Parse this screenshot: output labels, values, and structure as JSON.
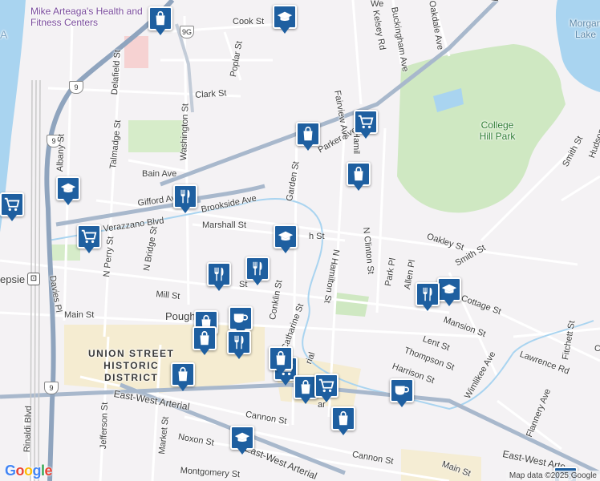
{
  "map": {
    "attribution": "Map data ©2025 Google",
    "logo": "Google",
    "colors": {
      "background": "#f4f2f4",
      "park": "#cfe8c2",
      "water": "#a9d4f0",
      "arterial": "#8fa4be",
      "road": "#ffffff",
      "marker": "#1e5fa0",
      "district_tint": "#f6e7b4"
    },
    "places": {
      "health_center": "Mike Arteaga's Health and Fitness Centers",
      "college_hill_park": "College Hill Park",
      "morgan_lake": "Morgan Lake",
      "union_street_district": "UNION STREET\nHISTORIC\nDISTRICT",
      "poughkeepsie_short": "Pough",
      "epsie_short": "epsie"
    },
    "route_shields": [
      "9G",
      "9",
      "9",
      "9"
    ],
    "streets": {
      "cook": "Cook St",
      "poplar": "Poplar St",
      "clark": "Clark St",
      "delafield": "Delafield St",
      "washington": "Washington St",
      "talmadge": "Talmadge St",
      "albany": "Albany St",
      "bain": "Bain Ave",
      "gifford": "Gifford Ave",
      "brookside": "Brookside Ave",
      "verazzano": "Verazzano Blvd",
      "marshall": "Marshall St",
      "garden": "Garden St",
      "parker": "Parker Ave",
      "fairview": "Fairview Ave",
      "kelsey": "Kelsey Rd",
      "buckingham": "Buckingham Ave",
      "oakdale": "Oakdale Ave",
      "hamilton_fragment": "Hamil",
      "smith": "Smith St",
      "hudson": "Hudson",
      "oakley": "Oakley St",
      "n_clinton": "N Clinton St",
      "n_hamilton": "N Hamilton St",
      "smith_sw": "Smith St",
      "high_fragment": "h St",
      "mill": "Mill St",
      "n_perry": "N Perry St",
      "n_bridge": "N Bridge St",
      "davies": "Davies Pl",
      "main": "Main St",
      "conklin": "Conklin St",
      "catharine": "Catharine St",
      "park_pl": "Park Pl",
      "allen_pl": "Allen Pl",
      "cottage": "Cottage St",
      "mansion": "Mansion St",
      "lent": "Lent St",
      "thompson": "Thompson St",
      "lawrence": "Lawrence Rd",
      "fitchett": "Fitchett St",
      "harrison": "Harrison St",
      "wimlikee": "Wimlikee Ave",
      "east_west_arterial": "East-West Arterial",
      "east_west_arterial_lower": "East-West Arterial",
      "east_west_arterial_right": "East-West Arte",
      "cannon": "Cannon St",
      "cannon_right": "Cannon St",
      "noxon": "Noxon St",
      "market": "Market St",
      "jefferson": "Jefferson St",
      "rinaldi": "Rinaldi Blvd",
      "montgomery": "Montgomery St",
      "flannery": "Flannery Ave",
      "main_right": "Main St",
      "fragment_st": "St",
      "fragment_sm": "Sm",
      "fragment_ve": "Ve",
      "fragment_a": "A",
      "fragment_ar": "ar",
      "fragment_co": "Co",
      "fragment_we": "We",
      "fragment_rial": "rial"
    },
    "markers": [
      {
        "name": "shopping-bag-marker-1",
        "icon": "shopping-bag-icon"
      },
      {
        "name": "school-marker-1",
        "icon": "school-icon"
      },
      {
        "name": "shopping-cart-marker-1",
        "icon": "shopping-cart-icon"
      },
      {
        "name": "shopping-bag-marker-2",
        "icon": "shopping-bag-icon"
      },
      {
        "name": "shopping-bag-marker-3",
        "icon": "shopping-bag-icon"
      },
      {
        "name": "school-marker-2",
        "icon": "school-icon"
      },
      {
        "name": "restaurant-marker-1",
        "icon": "restaurant-icon"
      },
      {
        "name": "shopping-cart-marker-2",
        "icon": "shopping-cart-icon"
      },
      {
        "name": "shopping-cart-marker-3",
        "icon": "shopping-cart-icon"
      },
      {
        "name": "school-marker-3",
        "icon": "school-icon"
      },
      {
        "name": "restaurant-marker-2",
        "icon": "restaurant-icon"
      },
      {
        "name": "restaurant-marker-3",
        "icon": "restaurant-icon"
      },
      {
        "name": "school-marker-4",
        "icon": "school-icon"
      },
      {
        "name": "restaurant-marker-4",
        "icon": "restaurant-icon"
      },
      {
        "name": "cafe-marker-1",
        "icon": "cafe-icon"
      },
      {
        "name": "shopping-bag-marker-4",
        "icon": "shopping-bag-icon"
      },
      {
        "name": "shopping-bag-marker-5",
        "icon": "shopping-bag-icon"
      },
      {
        "name": "restaurant-marker-5",
        "icon": "restaurant-icon"
      },
      {
        "name": "shopping-bag-marker-6",
        "icon": "shopping-bag-icon"
      },
      {
        "name": "shopping-cart-marker-4",
        "icon": "shopping-cart-icon"
      },
      {
        "name": "shopping-bag-marker-7",
        "icon": "shopping-bag-icon"
      },
      {
        "name": "shopping-cart-marker-5",
        "icon": "shopping-cart-icon"
      },
      {
        "name": "shopping-bag-marker-8",
        "icon": "shopping-bag-icon"
      },
      {
        "name": "cafe-marker-2",
        "icon": "cafe-icon"
      },
      {
        "name": "shopping-bag-marker-9",
        "icon": "shopping-bag-icon"
      },
      {
        "name": "school-marker-5",
        "icon": "school-icon"
      },
      {
        "name": "cafe-marker-3",
        "icon": "cafe-icon"
      }
    ]
  }
}
